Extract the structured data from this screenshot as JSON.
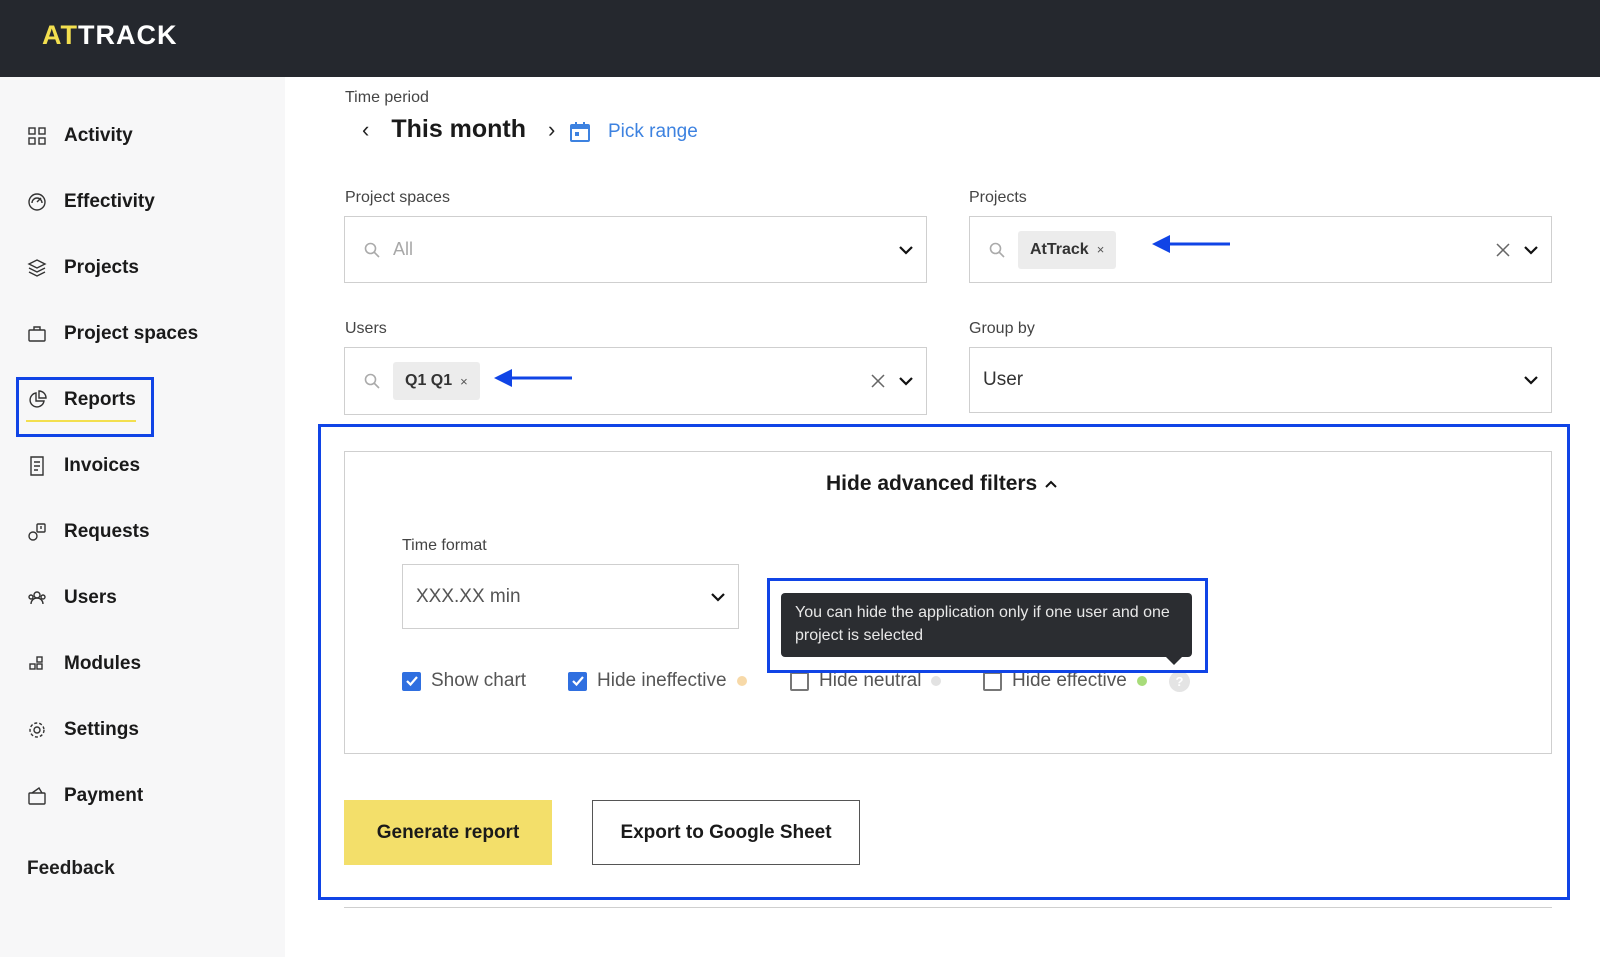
{
  "app": {
    "logo_accent": "AT",
    "logo_rest": "TRACK"
  },
  "sidebar": {
    "items": [
      {
        "label": "Activity",
        "icon": "grid-icon"
      },
      {
        "label": "Effectivity",
        "icon": "gauge-icon"
      },
      {
        "label": "Projects",
        "icon": "layers-icon"
      },
      {
        "label": "Project spaces",
        "icon": "briefcase-icon"
      },
      {
        "label": "Reports",
        "icon": "pie-chart-icon",
        "active": true
      },
      {
        "label": "Invoices",
        "icon": "receipt-icon"
      },
      {
        "label": "Requests",
        "icon": "request-icon"
      },
      {
        "label": "Users",
        "icon": "users-icon"
      },
      {
        "label": "Modules",
        "icon": "modules-icon"
      },
      {
        "label": "Settings",
        "icon": "gear-icon"
      },
      {
        "label": "Payment",
        "icon": "wallet-icon"
      }
    ],
    "feedback": "Feedback"
  },
  "filters": {
    "time_period_label": "Time period",
    "time_period_value": "This month",
    "prev": "‹",
    "next": "›",
    "pick_range": "Pick range",
    "project_spaces_label": "Project spaces",
    "project_spaces_placeholder": "All",
    "projects_label": "Projects",
    "projects_chip": "AtTrack",
    "users_label": "Users",
    "users_chip": "Q1 Q1",
    "group_by_label": "Group by",
    "group_by_value": "User",
    "chip_remove": "×"
  },
  "advanced": {
    "toggle_label": "Hide advanced filters",
    "time_format_label": "Time format",
    "time_format_value": "XXX.XX min",
    "checkboxes": [
      {
        "label": "Show chart",
        "checked": true
      },
      {
        "label": "Hide ineffective",
        "checked": true,
        "dot_color": "#f7d9a8"
      },
      {
        "label": "Hide neutral",
        "checked": false,
        "dot_color": "#e2e2e2"
      },
      {
        "label": "Hide effective",
        "checked": false,
        "dot_color": "#a8dc7a"
      }
    ],
    "help": "?",
    "tooltip": "You can hide the application only if one user and one project is selected"
  },
  "actions": {
    "generate": "Generate report",
    "export": "Export to Google Sheet"
  },
  "colors": {
    "accent_yellow": "#f3df4f",
    "highlight_blue": "#1044e6",
    "link_blue": "#3d82e0",
    "topbar": "#25282e"
  }
}
